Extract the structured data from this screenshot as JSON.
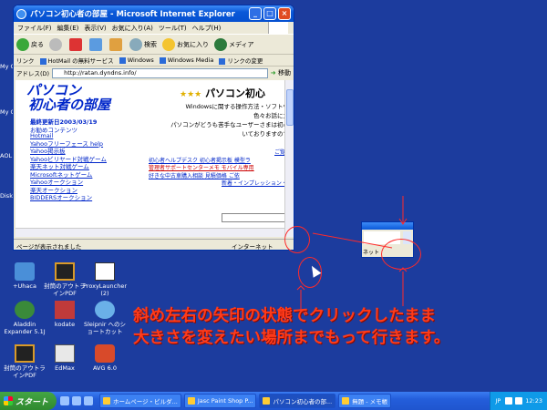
{
  "window": {
    "title": "パソコン初心者の部屋 - Microsoft Internet Explorer",
    "menu": [
      "ファイル(F)",
      "編集(E)",
      "表示(V)",
      "お気に入り(A)",
      "ツール(T)",
      "ヘルプ(H)"
    ],
    "toolbar": {
      "back": "戻る",
      "search": "検索",
      "favorites": "お気に入り",
      "media": "メディア"
    },
    "links_label": "リンク",
    "links": [
      "HotMail の無料サービス",
      "Windows",
      "Windows Media",
      "リンクの変更"
    ],
    "address_label": "アドレス(D)",
    "address": "http://ratan.dyndns.info/",
    "go": "移動",
    "status_text": "ページが表示されました",
    "zone": "インターネット"
  },
  "page": {
    "title_line1": "パソコン",
    "title_line2": "初心者の部屋",
    "updated": "最終更新日2003/03/19",
    "contents": "お勧めコンテンツ",
    "nav": [
      "Hotmail",
      "Yahooフリーフェース help",
      "Yahoo掲示板",
      "Yahooビリヤード対戦ゲーム",
      "楽天ネット対戦ゲーム",
      "Microsoftネットゲーム",
      "Yahooオークション",
      "楽天オークション",
      "BIDDERSオークション"
    ],
    "right_title": "パソコン初心",
    "stars": "★★★",
    "intro": [
      "Windowsに関する操作方法・ソフトウ",
      "色々お話に立",
      "パソコンがどうも苦手なユーザーさまは初心",
      "いておりますので"
    ],
    "links": [
      {
        "text": "ご覧",
        "red": false
      },
      {
        "text": "初心者ヘルプデスク 初心者掲示板 模型ラ",
        "red": false
      },
      {
        "text": "管理者サポートセンターメモ  モバイル専用",
        "red": true
      },
      {
        "text": "好きな中古車購入相談 見積価格 ご依",
        "red": false
      },
      {
        "text": "新着・インプレッション・",
        "red": false
      }
    ]
  },
  "mini_window": {
    "status": "ネット"
  },
  "desktop_icons": [
    {
      "label": "+Uhaca",
      "name": "uhaca"
    },
    {
      "label": "封筒のアウトラインPDF",
      "name": "pdf-outline-1"
    },
    {
      "label": "ProxyLauncher (2)",
      "name": "proxy-launcher"
    },
    {
      "label": "Aladdin Expander 5.1J",
      "name": "aladdin-expander"
    },
    {
      "label": "kodate",
      "name": "kodate"
    },
    {
      "label": "Sleipnir へのショートカット",
      "name": "sleipnir-shortcut"
    },
    {
      "label": "封筒のアウトラインPDF",
      "name": "pdf-outline-2"
    },
    {
      "label": "EdMax",
      "name": "edmax"
    },
    {
      "label": "AVG 6.0",
      "name": "avg"
    }
  ],
  "edge_labels": [
    "My C",
    "My Com",
    "AOL Me",
    "Disk"
  ],
  "annotation": {
    "line1": "斜め左右の矢印の状態でクリックしたまま",
    "line2": "大きさを変えたい場所までもって行きます。"
  },
  "taskbar": {
    "start": "スタート",
    "tasks": [
      "ホームページ・ビルダ...",
      "Jasc Paint Shop P...",
      "パソコン初心者の部...",
      "無題 - メモ帳"
    ],
    "active_task": 2,
    "lang": "JP",
    "time": "12:23"
  },
  "colors": {
    "desktop": "#1c3c9e",
    "annotation": "#ff3b1a",
    "link": "#0026c9"
  }
}
